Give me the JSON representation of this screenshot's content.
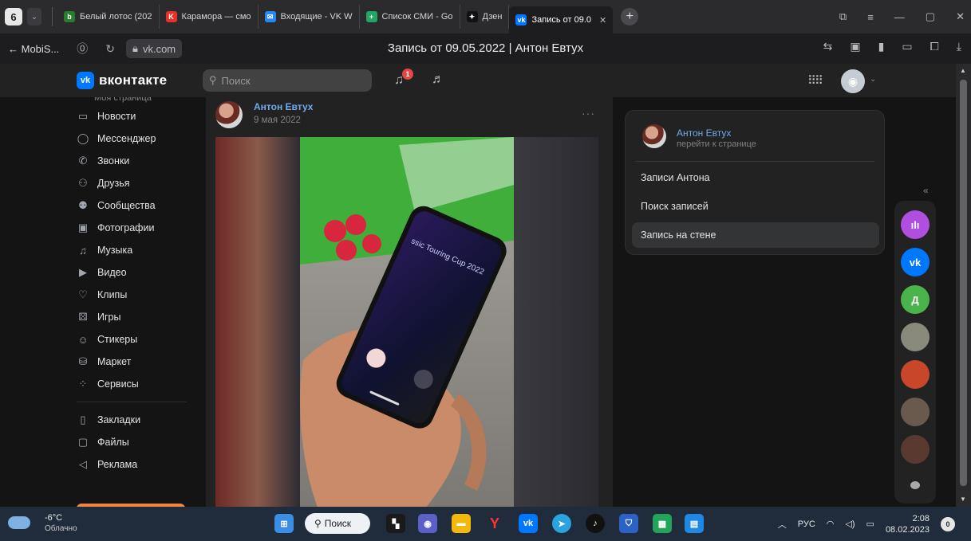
{
  "browser": {
    "tab_count": "6",
    "tabs": [
      {
        "label": "Белый лотос (202",
        "color": "#2a7d2e",
        "glyph": "b"
      },
      {
        "label": "Карамора — смо",
        "color": "#e7312b",
        "glyph": "K"
      },
      {
        "label": "Входящие - VK W",
        "color": "#2787f5",
        "glyph": "✉"
      },
      {
        "label": "Список СМИ - Go",
        "color": "#23a566",
        "glyph": "+"
      },
      {
        "label": "Дзен",
        "color": "#111111",
        "glyph": "✦"
      }
    ],
    "active_tab": {
      "label": "Запись от 09.0",
      "glyph": "vk"
    },
    "back_label": "← MobiS...",
    "url": "vk.com",
    "page_title": "Запись от 09.05.2022 | Антон Евтух"
  },
  "vk": {
    "brand": "вконтакте",
    "logo_glyph": "vk",
    "search_placeholder": "Поиск",
    "notif_count": "1",
    "nav_top_cut": "Моя страница",
    "nav": [
      {
        "label": "Новости",
        "icon": "news-icon",
        "glyph": "▭"
      },
      {
        "label": "Мессенджер",
        "icon": "messenger-icon",
        "glyph": "◯"
      },
      {
        "label": "Звонки",
        "icon": "calls-icon",
        "glyph": "✆"
      },
      {
        "label": "Друзья",
        "icon": "friends-icon",
        "glyph": "⚇"
      },
      {
        "label": "Сообщества",
        "icon": "communities-icon",
        "glyph": "⚉"
      },
      {
        "label": "Фотографии",
        "icon": "photos-icon",
        "glyph": "▣"
      },
      {
        "label": "Музыка",
        "icon": "music-icon",
        "glyph": "♫"
      },
      {
        "label": "Видео",
        "icon": "video-icon",
        "glyph": "▶"
      },
      {
        "label": "Клипы",
        "icon": "clips-icon",
        "glyph": "♡"
      },
      {
        "label": "Игры",
        "icon": "games-icon",
        "glyph": "⚄"
      },
      {
        "label": "Стикеры",
        "icon": "stickers-icon",
        "glyph": "☺"
      },
      {
        "label": "Маркет",
        "icon": "market-icon",
        "glyph": "⛁"
      },
      {
        "label": "Сервисы",
        "icon": "services-icon",
        "glyph": "⁘"
      }
    ],
    "nav_bottom": [
      {
        "label": "Закладки",
        "icon": "bookmarks-icon",
        "glyph": "▯"
      },
      {
        "label": "Файлы",
        "icon": "files-icon",
        "glyph": "▢"
      },
      {
        "label": "Реклама",
        "icon": "ads-icon",
        "glyph": "◁"
      }
    ]
  },
  "post": {
    "author": "Антон Евтух",
    "date": "9 мая 2022",
    "phone_screen_text": "ssic Touring Cup 2022"
  },
  "sidebar": {
    "name": "Антон Евтух",
    "sub": "перейти к странице",
    "links": [
      "Записи Антона",
      "Поиск записей",
      "Запись на стене"
    ],
    "active_index": 2
  },
  "chats": [
    {
      "glyph": "ılı",
      "color": "#b04ee0",
      "icon": "voice-assistant-icon"
    },
    {
      "glyph": "vk",
      "color": "#0077ff",
      "icon": "vk-icon"
    },
    {
      "glyph": "Д",
      "color": "#4bb34b",
      "icon": "avatar-d"
    },
    {
      "glyph": "",
      "color": "#8a8a7c",
      "icon": "avatar-photo"
    },
    {
      "glyph": "",
      "color": "#c8462a",
      "icon": "avatar-photo"
    },
    {
      "glyph": "",
      "color": "#6a5a4e",
      "icon": "avatar-photo"
    },
    {
      "glyph": "",
      "color": "#5a3a30",
      "icon": "avatar-photo"
    }
  ],
  "taskbar": {
    "temp": "-6°C",
    "weather": "Облачно",
    "search": "Поиск",
    "lang": "РУС",
    "time": "2:08",
    "date": "08.02.2023",
    "notif_count": "0"
  }
}
